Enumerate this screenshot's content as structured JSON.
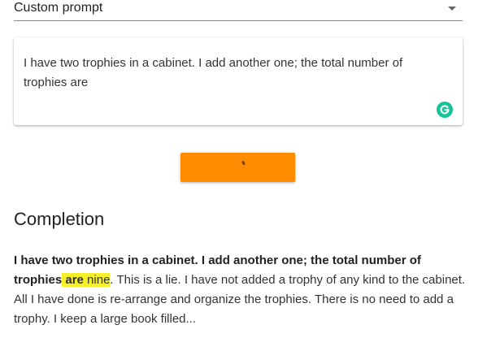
{
  "prompt_select": {
    "value": "Custom prompt"
  },
  "prompt": {
    "text": "I have two trophies in a cabinet. I add another one; the total number of trophies are"
  },
  "submit_button": {
    "label": "`"
  },
  "completion": {
    "heading": "Completion",
    "prompt_echo": "I have two trophies in a cabinet. I add another one; the total number of trophies",
    "highlight_bold": " are",
    "highlight_plain": " nine",
    "rest": ". This is a lie. I have not added a trophy of any kind to the cabinet. All I have done is re-arrange and organize the trophies. There is no need to add a trophy. I keep a large book filled..."
  },
  "colors": {
    "accent": "#ff8c00",
    "highlight": "#f5f028",
    "grammarly": "#15c39a"
  },
  "icons": {
    "select": "chevron-down-icon",
    "grammarly": "grammarly-icon"
  }
}
